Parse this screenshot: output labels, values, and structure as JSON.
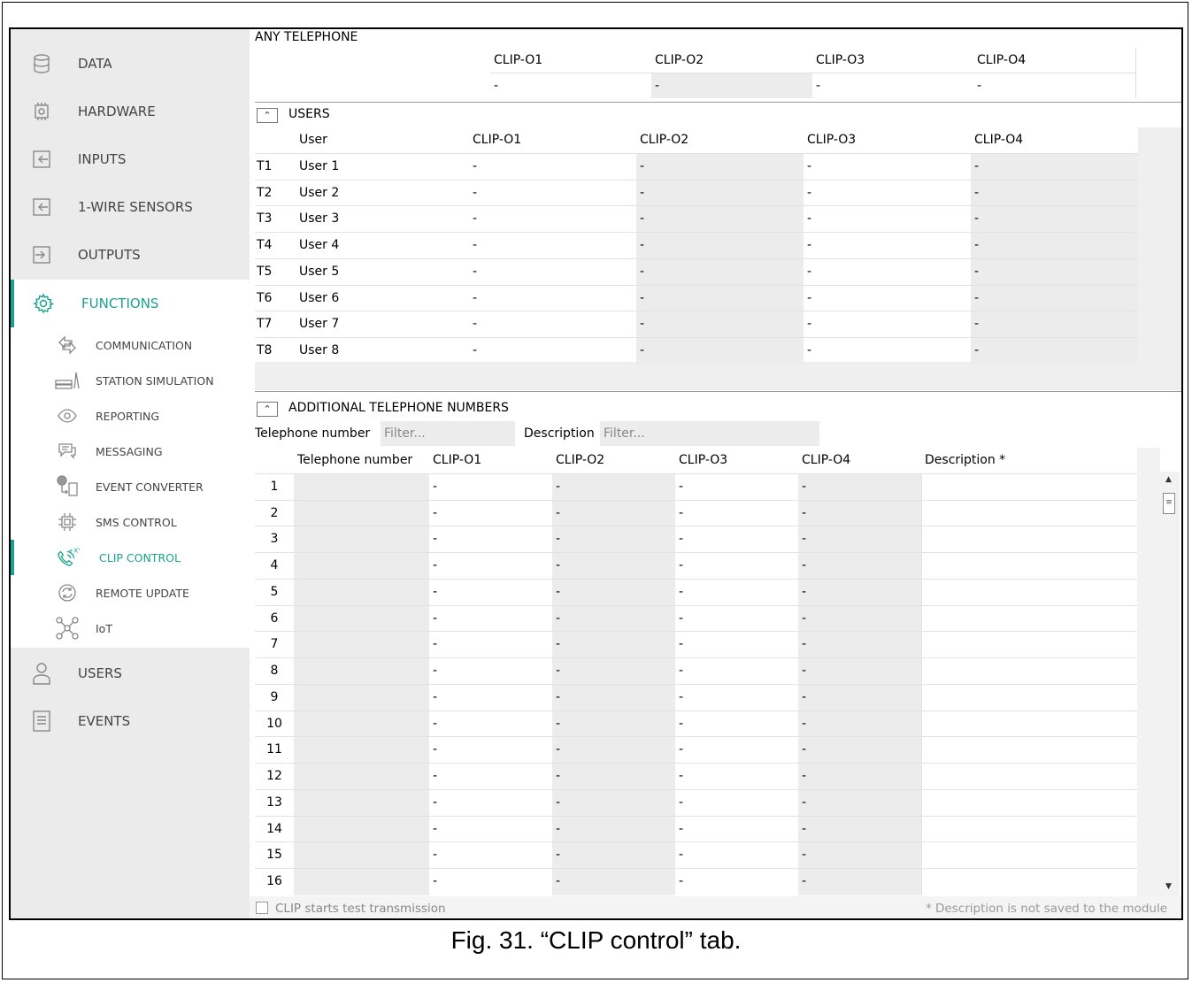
{
  "sidebar": {
    "main_items": [
      {
        "label": "DATA",
        "icon": "database-icon"
      },
      {
        "label": "HARDWARE",
        "icon": "chip-icon"
      },
      {
        "label": "INPUTS",
        "icon": "input-icon"
      },
      {
        "label": "1-WIRE SENSORS",
        "icon": "input-icon"
      },
      {
        "label": "OUTPUTS",
        "icon": "output-icon"
      },
      {
        "label": "FUNCTIONS",
        "icon": "gear-icon"
      }
    ],
    "sub_items": [
      {
        "label": "COMMUNICATION",
        "icon": "arrows-icon"
      },
      {
        "label": "STATION SIMULATION",
        "icon": "station-icon"
      },
      {
        "label": "REPORTING",
        "icon": "eye-icon"
      },
      {
        "label": "MESSAGING",
        "icon": "chat-icon"
      },
      {
        "label": "EVENT CONVERTER",
        "icon": "converter-icon"
      },
      {
        "label": "SMS CONTROL",
        "icon": "sms-icon"
      },
      {
        "label": "CLIP CONTROL",
        "icon": "phone-icon"
      },
      {
        "label": "REMOTE UPDATE",
        "icon": "update-icon"
      },
      {
        "label": "IoT",
        "icon": "network-icon"
      }
    ],
    "bottom_items": [
      {
        "label": "USERS",
        "icon": "user-icon"
      },
      {
        "label": "EVENTS",
        "icon": "list-icon"
      }
    ],
    "accent_color": "#1aa08f"
  },
  "any_telephone": {
    "title": "ANY TELEPHONE",
    "columns": [
      "CLIP-O1",
      "CLIP-O2",
      "CLIP-O3",
      "CLIP-O4"
    ],
    "values": [
      "-",
      "-",
      "-",
      "-"
    ]
  },
  "users_section": {
    "title": "USERS",
    "collapse_glyph": "⌃",
    "columns": [
      "User",
      "CLIP-O1",
      "CLIP-O2",
      "CLIP-O3",
      "CLIP-O4"
    ],
    "rows": [
      {
        "id": "T1",
        "user": "User 1",
        "values": [
          "-",
          "-",
          "-",
          "-"
        ]
      },
      {
        "id": "T2",
        "user": "User 2",
        "values": [
          "-",
          "-",
          "-",
          "-"
        ]
      },
      {
        "id": "T3",
        "user": "User 3",
        "values": [
          "-",
          "-",
          "-",
          "-"
        ]
      },
      {
        "id": "T4",
        "user": "User 4",
        "values": [
          "-",
          "-",
          "-",
          "-"
        ]
      },
      {
        "id": "T5",
        "user": "User 5",
        "values": [
          "-",
          "-",
          "-",
          "-"
        ]
      },
      {
        "id": "T6",
        "user": "User 6",
        "values": [
          "-",
          "-",
          "-",
          "-"
        ]
      },
      {
        "id": "T7",
        "user": "User 7",
        "values": [
          "-",
          "-",
          "-",
          "-"
        ]
      },
      {
        "id": "T8",
        "user": "User 8",
        "values": [
          "-",
          "-",
          "-",
          "-"
        ]
      }
    ]
  },
  "additional_section": {
    "title": "ADDITIONAL TELEPHONE NUMBERS",
    "collapse_glyph": "⌃",
    "filter_phone_label": "Telephone number",
    "filter_phone_placeholder": "Filter...",
    "filter_desc_label": "Description",
    "filter_desc_placeholder": "Filter...",
    "columns": [
      "Telephone number",
      "CLIP-O1",
      "CLIP-O2",
      "CLIP-O3",
      "CLIP-O4",
      "Description *"
    ],
    "rows": [
      {
        "num": "1",
        "values": [
          "-",
          "-",
          "-",
          "-"
        ]
      },
      {
        "num": "2",
        "values": [
          "-",
          "-",
          "-",
          "-"
        ]
      },
      {
        "num": "3",
        "values": [
          "-",
          "-",
          "-",
          "-"
        ]
      },
      {
        "num": "4",
        "values": [
          "-",
          "-",
          "-",
          "-"
        ]
      },
      {
        "num": "5",
        "values": [
          "-",
          "-",
          "-",
          "-"
        ]
      },
      {
        "num": "6",
        "values": [
          "-",
          "-",
          "-",
          "-"
        ]
      },
      {
        "num": "7",
        "values": [
          "-",
          "-",
          "-",
          "-"
        ]
      },
      {
        "num": "8",
        "values": [
          "-",
          "-",
          "-",
          "-"
        ]
      },
      {
        "num": "9",
        "values": [
          "-",
          "-",
          "-",
          "-"
        ]
      },
      {
        "num": "10",
        "values": [
          "-",
          "-",
          "-",
          "-"
        ]
      },
      {
        "num": "11",
        "values": [
          "-",
          "-",
          "-",
          "-"
        ]
      },
      {
        "num": "12",
        "values": [
          "-",
          "-",
          "-",
          "-"
        ]
      },
      {
        "num": "13",
        "values": [
          "-",
          "-",
          "-",
          "-"
        ]
      },
      {
        "num": "14",
        "values": [
          "-",
          "-",
          "-",
          "-"
        ]
      },
      {
        "num": "15",
        "values": [
          "-",
          "-",
          "-",
          "-"
        ]
      },
      {
        "num": "16",
        "values": [
          "-",
          "-",
          "-",
          "-"
        ]
      }
    ]
  },
  "footer": {
    "checkbox_label": "CLIP starts test transmission",
    "note": "* Description is not saved to the module"
  },
  "caption": "Fig. 31. “CLIP control” tab."
}
